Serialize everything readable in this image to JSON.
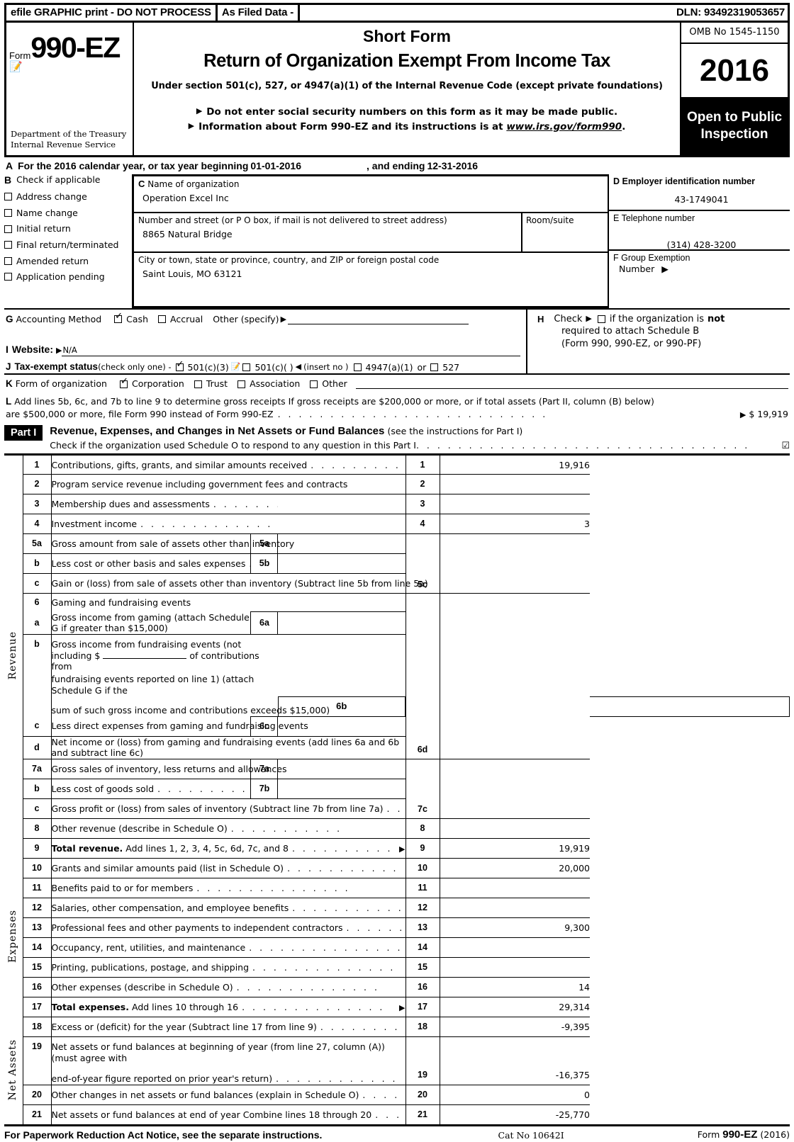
{
  "efile_header": {
    "left": "efile GRAPHIC print - DO NOT PROCESS",
    "middle": "As Filed Data -",
    "dln": "DLN: 93492319053657"
  },
  "masthead": {
    "form_word": "Form",
    "form_number": "990-EZ",
    "agency_line1": "Department of the Treasury",
    "agency_line2": "Internal Revenue Service",
    "short_form": "Short Form",
    "title": "Return of Organization Exempt From Income Tax",
    "subtitle": "Under section 501(c), 527, or 4947(a)(1) of the Internal Revenue Code (except private foundations)",
    "bullet1": "Do not enter social security numbers on this form as it may be made public.",
    "bullet2_pre": "Information about Form 990-EZ and its instructions is at ",
    "bullet2_link": "www.irs.gov/form990",
    "bullet2_post": ".",
    "omb": "OMB No  1545-1150",
    "year": "2016",
    "open_line1": "Open to Public",
    "open_line2": "Inspection"
  },
  "section_a": {
    "letter": "A",
    "text1": "For the 2016 calendar year, or tax year beginning",
    "begin_date": "01-01-2016",
    "text2": ", and ending",
    "end_date": "12-31-2016"
  },
  "section_b": {
    "letter": "B",
    "heading": "Check if applicable",
    "options": [
      {
        "label": "Address change",
        "checked": false
      },
      {
        "label": "Name change",
        "checked": false
      },
      {
        "label": "Initial return",
        "checked": false
      },
      {
        "label": "Final return/terminated",
        "checked": false
      },
      {
        "label": "Amended return",
        "checked": false
      },
      {
        "label": "Application pending",
        "checked": false
      }
    ]
  },
  "section_c": {
    "letter": "C",
    "name_label": "Name of organization",
    "name_value": "Operation Excel Inc",
    "street_label": "Number and street (or P  O  box, if mail is not delivered to street address)",
    "street_value": "8865 Natural Bridge",
    "room_label": "Room/suite",
    "room_value": "",
    "city_label": " City or town, state or province, country, and ZIP or foreign postal code",
    "city_value": "Saint Louis, MO  63121"
  },
  "section_d": {
    "letter": "D",
    "ein_label": "Employer identification number",
    "ein_value": "43-1749041",
    "letter_e": "E",
    "phone_label": "Telephone number",
    "phone_value": "(314) 428-3200",
    "letter_f": "F",
    "group_label": "Group Exemption",
    "group_label2": "Number",
    "group_value": ""
  },
  "section_g": {
    "letter": "G",
    "label": "Accounting Method",
    "cash": "Cash",
    "cash_checked": true,
    "accrual": "Accrual",
    "accrual_checked": false,
    "other": "Other (specify)",
    "other_value": ""
  },
  "section_h": {
    "letter": "H",
    "line1_pre": "Check",
    "line1_post_a": "if the organization is",
    "line1_post_b": "not",
    "line2": "required to attach Schedule B",
    "line3": "(Form 990, 990-EZ, or 990-PF)",
    "checked": false
  },
  "section_i": {
    "letter": "I",
    "label": "Website:",
    "value": "N/A"
  },
  "section_j": {
    "letter": "J",
    "label": "Tax-exempt status",
    "sub": "(check only one) -",
    "opt1": "501(c)(3)",
    "opt1_checked": true,
    "opt2": "501(c)(  )",
    "opt2_checked": false,
    "insert": "(insert no )",
    "opt3": "4947(a)(1)",
    "opt3_checked": false,
    "or": "or",
    "opt4": "527",
    "opt4_checked": false
  },
  "section_k": {
    "letter": "K",
    "label": "Form of organization",
    "options": [
      {
        "label": "Corporation",
        "checked": true
      },
      {
        "label": "Trust",
        "checked": false
      },
      {
        "label": "Association",
        "checked": false
      },
      {
        "label": "Other",
        "checked": false
      }
    ]
  },
  "section_l": {
    "letter": "L",
    "line1": "Add lines 5b, 6c, and 7b to line 9 to determine gross receipts  If gross receipts are $200,000 or more, or if total assets (Part II, column (B) below)",
    "line2": "are $500,000 or more, file Form 990 instead of Form 990-EZ",
    "amount": "$ 19,919"
  },
  "part1": {
    "badge": "Part I",
    "title": "Revenue, Expenses, and Changes in Net Assets or Fund Balances",
    "title_note": "(see the instructions for Part I)",
    "check_text": "Check if the organization used Schedule O to respond to any question in this Part I",
    "checked": true,
    "side_labels": {
      "revenue": "Revenue",
      "expenses": "Expenses",
      "net_assets": "Net Assets"
    },
    "rows": [
      {
        "no": "1",
        "desc": "Contributions, gifts, grants, and similar amounts received",
        "line": "1",
        "amount": "19,916"
      },
      {
        "no": "2",
        "desc": "Program service revenue including government fees and contracts",
        "line": "2",
        "amount": ""
      },
      {
        "no": "3",
        "desc": "Membership dues and assessments",
        "line": "3",
        "amount": ""
      },
      {
        "no": "4",
        "desc": "Investment income",
        "line": "4",
        "amount": "3"
      },
      {
        "no": "5a",
        "desc": "Gross amount from sale of assets other than inventory",
        "inner": "5a",
        "inner_amount": ""
      },
      {
        "no": "b",
        "desc": "Less  cost or other basis and sales expenses",
        "inner": "5b",
        "inner_amount": ""
      },
      {
        "no": "c",
        "desc": "Gain or (loss) from sale of assets other than inventory (Subtract line 5b from line 5a)",
        "line": "5c",
        "amount": ""
      },
      {
        "no": "6",
        "desc": "Gaming and fundraising events"
      },
      {
        "no": "a",
        "desc": "Gross income from gaming (attach Schedule G if greater than $15,000)",
        "inner": "6a",
        "inner_amount": ""
      },
      {
        "no": "b",
        "desc_l1": "Gross income from fundraising events (not including $",
        "desc_l1b": "of contributions from",
        "desc_l2": "fundraising events reported on line 1) (attach Schedule G if the",
        "desc_l3": "sum of such gross income and contributions exceeds $15,000)",
        "inner": "6b",
        "inner_amount": ""
      },
      {
        "no": "c",
        "desc": "Less  direct expenses from gaming and fundraising events",
        "inner": "6c",
        "inner_amount": ""
      },
      {
        "no": "d",
        "desc": "Net income or (loss) from gaming and fundraising events (add lines 6a and 6b and subtract line 6c)",
        "line": "6d",
        "amount": ""
      },
      {
        "no": "7a",
        "desc": "Gross sales of inventory, less returns and allowances",
        "inner": "7a",
        "inner_amount": ""
      },
      {
        "no": "b",
        "desc": "Less  cost of goods sold",
        "inner": "7b",
        "inner_amount": ""
      },
      {
        "no": "c",
        "desc": "Gross profit or (loss) from sales of inventory (Subtract line 7b from line 7a)",
        "line": "7c",
        "amount": ""
      },
      {
        "no": "8",
        "desc": "Other revenue (describe in Schedule O)",
        "line": "8",
        "amount": ""
      },
      {
        "no": "9",
        "desc_bold": "Total revenue.",
        "desc": "Add lines 1, 2, 3, 4, 5c, 6d, 7c, and 8",
        "line": "9",
        "amount": "19,919",
        "arrow": true
      },
      {
        "no": "10",
        "desc": "Grants and similar amounts paid (list in Schedule O)",
        "line": "10",
        "amount": "20,000"
      },
      {
        "no": "11",
        "desc": "Benefits paid to or for members",
        "line": "11",
        "amount": ""
      },
      {
        "no": "12",
        "desc": "Salaries, other compensation, and employee benefits",
        "line": "12",
        "amount": ""
      },
      {
        "no": "13",
        "desc": "Professional fees and other payments to independent contractors",
        "line": "13",
        "amount": "9,300"
      },
      {
        "no": "14",
        "desc": "Occupancy, rent, utilities, and maintenance",
        "line": "14",
        "amount": ""
      },
      {
        "no": "15",
        "desc": "Printing, publications, postage, and shipping",
        "line": "15",
        "amount": ""
      },
      {
        "no": "16",
        "desc": "Other expenses (describe in Schedule O)",
        "line": "16",
        "amount": "14"
      },
      {
        "no": "17",
        "desc_bold": "Total expenses.",
        "desc": "Add lines 10 through 16",
        "line": "17",
        "amount": "29,314",
        "arrow": true
      },
      {
        "no": "18",
        "desc": "Excess or (deficit) for the year (Subtract line 17 from line 9)",
        "line": "18",
        "amount": "-9,395"
      },
      {
        "no": "19",
        "desc_l1": "Net assets or fund balances at beginning of year (from line 27, column (A)) (must agree with",
        "desc_l2": "end-of-year figure reported on prior year's return)",
        "line": "19",
        "amount": "-16,375"
      },
      {
        "no": "20",
        "desc": "Other changes in net assets or fund balances (explain in Schedule O)",
        "line": "20",
        "amount": "0"
      },
      {
        "no": "21",
        "desc": "Net assets or fund balances at end of year  Combine lines 18 through 20",
        "line": "21",
        "amount": "-25,770"
      }
    ]
  },
  "footer": {
    "left": "For Paperwork Reduction Act Notice, see the separate instructions.",
    "cat": "Cat  No  10642I",
    "right_pre": "Form ",
    "right_form": "990-EZ",
    "right_year": " (2016)"
  }
}
